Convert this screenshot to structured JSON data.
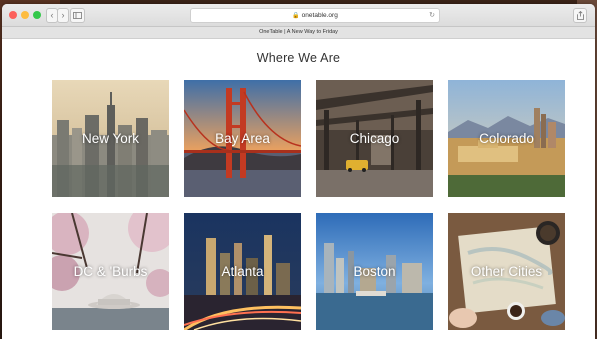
{
  "browser": {
    "url": "onetable.org",
    "tab_title": "OneTable | A New Way to Friday",
    "back_icon": "‹",
    "forward_icon": "›",
    "reload_icon": "↻"
  },
  "page": {
    "heading": "Where We Are"
  },
  "locations": [
    {
      "label": "New York"
    },
    {
      "label": "Bay Area"
    },
    {
      "label": "Chicago"
    },
    {
      "label": "Colorado"
    },
    {
      "label": "DC & 'Burbs"
    },
    {
      "label": "Atlanta"
    },
    {
      "label": "Boston"
    },
    {
      "label": "Other Cities"
    }
  ]
}
